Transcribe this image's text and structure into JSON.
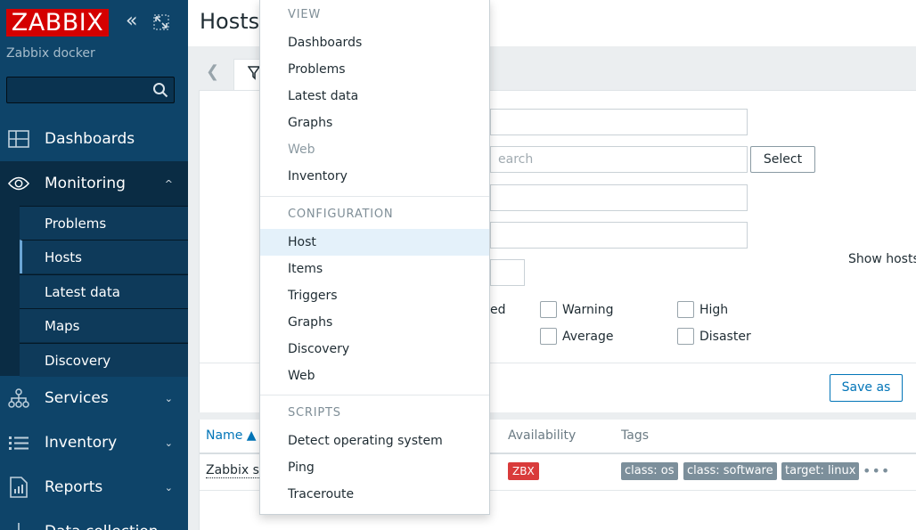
{
  "sidebar": {
    "logo": "ZABBIX",
    "server_name": "Zabbix docker",
    "search_value": "",
    "nav": [
      {
        "label": "Dashboards"
      },
      {
        "label": "Monitoring"
      },
      {
        "label": "Services"
      },
      {
        "label": "Inventory"
      },
      {
        "label": "Reports"
      },
      {
        "label": "Data collection"
      }
    ],
    "monitoring_sub": [
      {
        "label": "Problems"
      },
      {
        "label": "Hosts"
      },
      {
        "label": "Latest data"
      },
      {
        "label": "Maps"
      },
      {
        "label": "Discovery"
      }
    ]
  },
  "header": {
    "title": "Hosts"
  },
  "filter": {
    "host_groups_placeholder": "earch",
    "select_label": "Select",
    "show_hosts_label": "Show hosts",
    "severity_partial": "ed",
    "severities": [
      {
        "label": "Warning"
      },
      {
        "label": "High"
      },
      {
        "label": "Average"
      },
      {
        "label": "Disaster"
      }
    ],
    "save_as_label": "Save as"
  },
  "table": {
    "columns": [
      {
        "label": "Name ▲"
      },
      {
        "label": "Availability"
      },
      {
        "label": "Tags"
      }
    ],
    "rows": [
      {
        "name": "Zabbix se",
        "availability": "ZBX",
        "tags": [
          "class: os",
          "class: software",
          "target: linux"
        ],
        "more": "•••"
      }
    ]
  },
  "dropdown": {
    "sections": [
      {
        "header": "VIEW",
        "items": [
          {
            "label": "Dashboards"
          },
          {
            "label": "Problems"
          },
          {
            "label": "Latest data"
          },
          {
            "label": "Graphs"
          },
          {
            "label": "Web"
          },
          {
            "label": "Inventory"
          }
        ]
      },
      {
        "header": "CONFIGURATION",
        "items": [
          {
            "label": "Host"
          },
          {
            "label": "Items"
          },
          {
            "label": "Triggers"
          },
          {
            "label": "Graphs"
          },
          {
            "label": "Discovery"
          },
          {
            "label": "Web"
          }
        ]
      },
      {
        "header": "SCRIPTS",
        "items": [
          {
            "label": "Detect operating system"
          },
          {
            "label": "Ping"
          },
          {
            "label": "Traceroute"
          }
        ]
      }
    ]
  },
  "colors": {
    "sidebar_bg": "#0e4469",
    "logo_bg": "#d40000",
    "accent": "#0275b8",
    "zbx_unavailable": "#d93b3b",
    "tag_bg": "#7c8f9b"
  }
}
